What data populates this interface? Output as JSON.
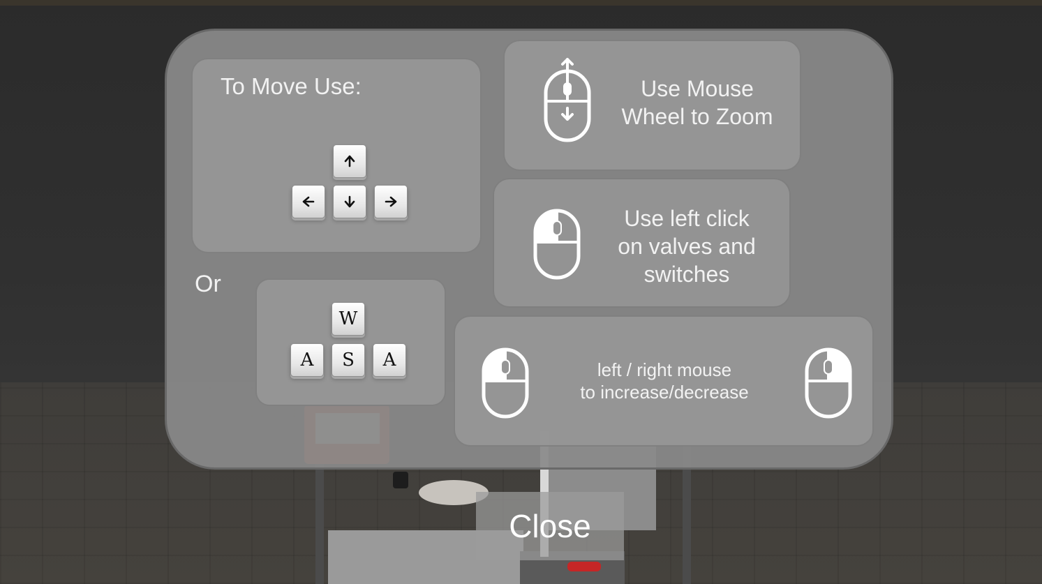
{
  "move_card": {
    "title": "To Move Use:",
    "arrow_keys": {
      "up": "arrow-up",
      "left": "arrow-left",
      "down": "arrow-down",
      "right": "arrow-right"
    }
  },
  "or_label": "Or",
  "letter_keys": {
    "top": "W",
    "left": "A",
    "middle": "S",
    "right": "A"
  },
  "zoom_card": {
    "line1": "Use Mouse",
    "line2": "Wheel  to Zoom",
    "icon": "mouse-scroll-icon"
  },
  "click_card": {
    "line1": "Use left click",
    "line2": "on valves and",
    "line3": "switches",
    "icon": "mouse-left-click-icon"
  },
  "adjust_card": {
    "line1": "left / right mouse",
    "line2": "to increase/decrease",
    "icons": [
      "mouse-left-click-icon",
      "mouse-right-click-icon"
    ]
  },
  "close_button": {
    "label": "Close"
  },
  "colors": {
    "panel": "#8a8a8a",
    "card": "#969696",
    "text": "#f2f2f2",
    "key_face": "#ffffff"
  }
}
